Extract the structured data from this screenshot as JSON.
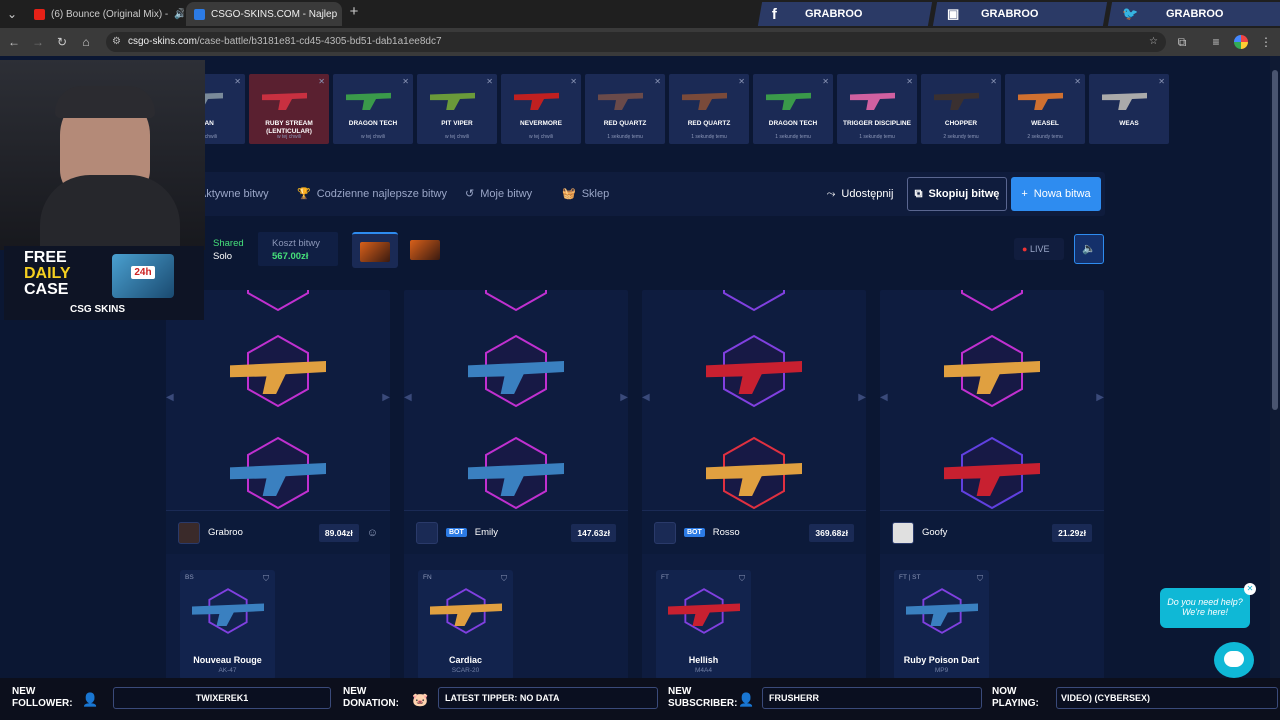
{
  "browser": {
    "tabs": [
      {
        "label": "(6) Bounce (Original Mix) -",
        "active": false
      },
      {
        "label": "CSGO-SKINS.COM - Najlep",
        "active": true
      }
    ],
    "url_domain": "csgo-skins.com",
    "url_path": "/case-battle/b3181e81-cd45-4305-bd51-dab1a1ee8dc7"
  },
  "social": [
    {
      "icon": "facebook-icon",
      "name": "GRABROO"
    },
    {
      "icon": "twitch-icon",
      "name": "GRABROO"
    },
    {
      "icon": "twitter-icon",
      "name": "GRABROO"
    }
  ],
  "live_drops": [
    {
      "name": "IDIAN",
      "sub": "w tej chwili",
      "color": "#1b2a55"
    },
    {
      "name": "RUBY STREAM (LENTICULAR)",
      "sub": "w tej chwili",
      "color": "#5a2030"
    },
    {
      "name": "DRAGON TECH",
      "sub": "w tej chwili",
      "color": "#1b2a55"
    },
    {
      "name": "PIT VIPER",
      "sub": "w tej chwili",
      "color": "#1b2a55"
    },
    {
      "name": "NEVERMORE",
      "sub": "w tej chwili",
      "color": "#1b2a55"
    },
    {
      "name": "RED QUARTZ",
      "sub": "1 sekundę temu",
      "color": "#1b2a55"
    },
    {
      "name": "RED QUARTZ",
      "sub": "1 sekundę temu",
      "color": "#1b2a55"
    },
    {
      "name": "DRAGON TECH",
      "sub": "1 sekundę temu",
      "color": "#1b2a55"
    },
    {
      "name": "TRIGGER DISCIPLINE",
      "sub": "1 sekundę temu",
      "color": "#1b2a55"
    },
    {
      "name": "CHOPPER",
      "sub": "2 sekundy temu",
      "color": "#1b2a55"
    },
    {
      "name": "WEASEL",
      "sub": "2 sekundy temu",
      "color": "#1b2a55"
    },
    {
      "name": "WEAS",
      "sub": "",
      "color": "#1b2a55"
    }
  ],
  "nav": {
    "active_battles": "Aktywne bitwy",
    "daily_best": "Codzienne najlepsze bitwy",
    "my_battles": "Moje bitwy",
    "shop": "Sklep",
    "share": "Udostępnij",
    "copy_battle": "Skopiuj bitwę",
    "new_battle": "Nowa bitwa"
  },
  "battle": {
    "mode_top": "Shared",
    "mode_bottom": "Solo",
    "cost_label": "Koszt bitwy",
    "cost_value": "567.00zł",
    "live_label": "LIVE"
  },
  "players": [
    {
      "name": "Grabroo",
      "bot": false,
      "amount": "89.04zł",
      "item_cond": "BS",
      "item_name": "Nouveau Rouge",
      "item_type": "AK-47"
    },
    {
      "name": "Emily",
      "bot": true,
      "bot_label": "BOT",
      "amount": "147.63zł",
      "item_cond": "FN",
      "item_name": "Cardiac",
      "item_type": "SCAR-20"
    },
    {
      "name": "Rosso",
      "bot": true,
      "bot_label": "BOT",
      "amount": "369.68zł",
      "item_cond": "FT",
      "item_name": "Hellish",
      "item_type": "M4A4"
    },
    {
      "name": "Goofy",
      "bot": false,
      "amount": "21.29zł",
      "item_cond": "FT | ST",
      "item_name": "Ruby Poison Dart",
      "item_type": "MP9"
    }
  ],
  "overlay": {
    "promo_line1": "FREE",
    "promo_line2": "DAILY",
    "promo_line3": "CASE",
    "promo_brand": "CSG SKINS",
    "promo_badge": "24h"
  },
  "bottom_bar": {
    "follower_label": "NEW FOLLOWER:",
    "follower_value": "TWIXEREK1",
    "donation_label": "NEW DONATION:",
    "donation_value": "LATEST TIPPER: NO DATA",
    "subscriber_label": "NEW SUBSCRIBER:",
    "subscriber_value": "FRUSHERR",
    "playing_label": "NOW PLAYING:",
    "playing_value": "VIDEO) (CYBERSEX)"
  },
  "chat_widget": {
    "text": "Do you need help? We're here!"
  }
}
